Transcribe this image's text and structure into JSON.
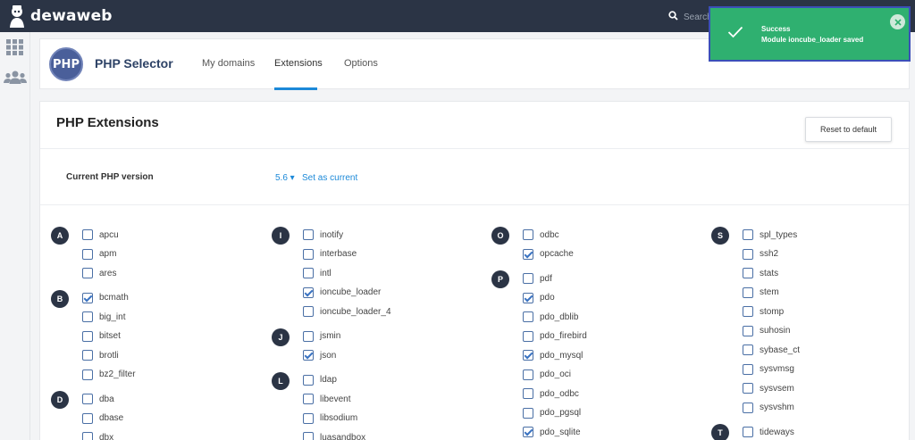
{
  "brand": {
    "name": "dewaweb"
  },
  "search": {
    "placeholder": "Search"
  },
  "header": {
    "title": "PHP Selector",
    "logo_text": "PHP",
    "tabs": [
      {
        "label": "My domains"
      },
      {
        "label": "Extensions",
        "active": true
      },
      {
        "label": "Options"
      }
    ]
  },
  "page": {
    "title": "PHP Extensions",
    "reset_label": "Reset to default",
    "version_label": "Current PHP version",
    "version_value": "5.6 ▾",
    "set_current_label": "Set as current"
  },
  "toast": {
    "title": "Success",
    "message": "Module ioncube_loader saved",
    "color": "#2fb070"
  },
  "extension_groups": [
    {
      "letter": "A",
      "items": [
        {
          "name": "apcu",
          "checked": false
        },
        {
          "name": "apm",
          "checked": false
        },
        {
          "name": "ares",
          "checked": false
        }
      ]
    },
    {
      "letter": "B",
      "items": [
        {
          "name": "bcmath",
          "checked": true
        },
        {
          "name": "big_int",
          "checked": false
        },
        {
          "name": "bitset",
          "checked": false
        },
        {
          "name": "brotli",
          "checked": false
        },
        {
          "name": "bz2_filter",
          "checked": false
        }
      ]
    },
    {
      "letter": "D",
      "items": [
        {
          "name": "dba",
          "checked": false
        },
        {
          "name": "dbase",
          "checked": false
        },
        {
          "name": "dbx",
          "checked": false
        }
      ]
    },
    {
      "letter": "I",
      "items": [
        {
          "name": "inotify",
          "checked": false
        },
        {
          "name": "interbase",
          "checked": false
        },
        {
          "name": "intl",
          "checked": false
        },
        {
          "name": "ioncube_loader",
          "checked": true
        },
        {
          "name": "ioncube_loader_4",
          "checked": false
        }
      ]
    },
    {
      "letter": "J",
      "items": [
        {
          "name": "jsmin",
          "checked": false
        },
        {
          "name": "json",
          "checked": true
        }
      ]
    },
    {
      "letter": "L",
      "items": [
        {
          "name": "ldap",
          "checked": false
        },
        {
          "name": "libevent",
          "checked": false
        },
        {
          "name": "libsodium",
          "checked": false
        },
        {
          "name": "luasandbox",
          "checked": false
        }
      ]
    },
    {
      "letter": "O",
      "items": [
        {
          "name": "odbc",
          "checked": false
        },
        {
          "name": "opcache",
          "checked": true
        }
      ]
    },
    {
      "letter": "P",
      "items": [
        {
          "name": "pdf",
          "checked": false
        },
        {
          "name": "pdo",
          "checked": true
        },
        {
          "name": "pdo_dblib",
          "checked": false
        },
        {
          "name": "pdo_firebird",
          "checked": false
        },
        {
          "name": "pdo_mysql",
          "checked": true
        },
        {
          "name": "pdo_oci",
          "checked": false
        },
        {
          "name": "pdo_odbc",
          "checked": false
        },
        {
          "name": "pdo_pgsql",
          "checked": false
        },
        {
          "name": "pdo_sqlite",
          "checked": true
        }
      ]
    },
    {
      "letter": "S",
      "items": [
        {
          "name": "spl_types",
          "checked": false
        },
        {
          "name": "ssh2",
          "checked": false
        },
        {
          "name": "stats",
          "checked": false
        },
        {
          "name": "stem",
          "checked": false
        },
        {
          "name": "stomp",
          "checked": false
        },
        {
          "name": "suhosin",
          "checked": false
        },
        {
          "name": "sybase_ct",
          "checked": false
        },
        {
          "name": "sysvmsg",
          "checked": false
        },
        {
          "name": "sysvsem",
          "checked": false
        },
        {
          "name": "sysvshm",
          "checked": false
        }
      ]
    },
    {
      "letter": "T",
      "items": [
        {
          "name": "tideways",
          "checked": false
        }
      ]
    }
  ]
}
